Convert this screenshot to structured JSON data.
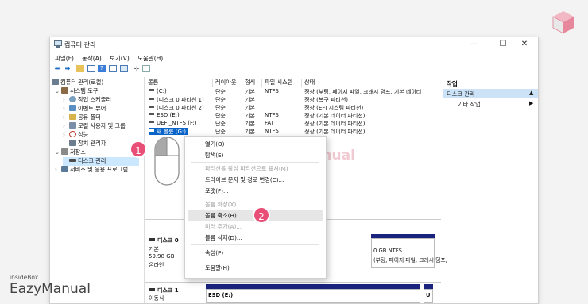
{
  "window": {
    "title": "컴퓨터 관리",
    "controls": [
      "—",
      "☐",
      "✕"
    ]
  },
  "menu": [
    "파일(F)",
    "동작(A)",
    "보기(V)",
    "도움말(H)"
  ],
  "toolbar_icons": [
    "back-arrow",
    "forward-arrow",
    "folder",
    "list",
    "help",
    "view",
    "zoom",
    "panel"
  ],
  "tree": [
    {
      "label": "컴퓨터 관리(로컬)",
      "indent": 0,
      "twisty": "",
      "color": "#6b7d8f"
    },
    {
      "label": "시스템 도구",
      "indent": 1,
      "twisty": "⌄",
      "color": "#8a6b45"
    },
    {
      "label": "작업 스케줄러",
      "indent": 2,
      "twisty": "›",
      "color": "#7aa0bf"
    },
    {
      "label": "이벤트 뷰어",
      "indent": 2,
      "twisty": "›",
      "color": "#5a8fc4"
    },
    {
      "label": "공유 폴더",
      "indent": 2,
      "twisty": "›",
      "color": "#d8b24a"
    },
    {
      "label": "로컬 사용자 및 그룹",
      "indent": 2,
      "twisty": "›",
      "color": "#7b8fa8"
    },
    {
      "label": "성능",
      "indent": 2,
      "twisty": "›",
      "color": "#c0392b"
    },
    {
      "label": "장치 관리자",
      "indent": 2,
      "twisty": "",
      "color": "#6b7d8f"
    },
    {
      "label": "저장소",
      "indent": 1,
      "twisty": "⌄",
      "color": "#8a8a8a"
    },
    {
      "label": "디스크 관리",
      "indent": 2,
      "twisty": "",
      "color": "#4a4a4a",
      "selected": true
    },
    {
      "label": "서비스 및 응용 프로그램",
      "indent": 1,
      "twisty": "›",
      "color": "#5a7a9a"
    }
  ],
  "volume_list": {
    "headers": [
      "볼륨",
      "레이아웃",
      "형식",
      "파일 시스템",
      "상태"
    ],
    "rows": [
      {
        "name": "(C:)",
        "layout": "단순",
        "type": "기본",
        "fs": "NTFS",
        "status": "정상 (부팅, 페이지 파일, 크래시 덤프, 기본 데이터"
      },
      {
        "name": "(디스크 0 파티션 1)",
        "layout": "단순",
        "type": "기본",
        "fs": "",
        "status": "정상 (복구 파티션)"
      },
      {
        "name": "(디스크 0 파티션 2)",
        "layout": "단순",
        "type": "기본",
        "fs": "",
        "status": "정상 (EFI 시스템 파티션)"
      },
      {
        "name": "ESD (E:)",
        "layout": "단순",
        "type": "기본",
        "fs": "NTFS",
        "status": "정상 (기본 데이터 파티션)"
      },
      {
        "name": "UEFI_NTFS (F:)",
        "layout": "단순",
        "type": "기본",
        "fs": "FAT",
        "status": "정상 (기본 데이터 파티션)"
      },
      {
        "name": "새 볼륨 (G:)",
        "layout": "단순",
        "type": "기본",
        "fs": "NTFS",
        "status": "정상 (기본 데이터 파티션)",
        "selected": true
      }
    ]
  },
  "disk0": {
    "label": "디스크 0",
    "kind": "기본",
    "size": "59.98 GB",
    "state": "온라인",
    "partition_size": "0 GB NTFS",
    "partition_status": "(부팅, 페이지 파일, 크래시 덤프,"
  },
  "disk1": {
    "label": "디스크 1",
    "kind": "이동식",
    "partition_name": "ESD (E:)",
    "partition_tail": "U"
  },
  "actions": {
    "title": "작업",
    "section": "디스크 관리",
    "item": "기타 작업"
  },
  "context_menu": {
    "items": [
      {
        "label": "열기(O)",
        "disabled": false
      },
      {
        "label": "탐색(E)",
        "disabled": false
      },
      {
        "sep": true
      },
      {
        "label": "파티션을 활성 파티션으로 표시(M)",
        "disabled": true
      },
      {
        "label": "드라이브 문자 및 경로 변경(C)...",
        "disabled": false
      },
      {
        "label": "포맷(F)...",
        "disabled": false
      },
      {
        "sep": true
      },
      {
        "label": "볼륨 확장(X)...",
        "disabled": true
      },
      {
        "label": "볼륨 축소(H)...",
        "disabled": false,
        "highlight": true
      },
      {
        "label": "미러 추가(A)...",
        "disabled": true
      },
      {
        "label": "볼륨 삭제(D)...",
        "disabled": false
      },
      {
        "sep": true
      },
      {
        "label": "속성(P)",
        "disabled": false
      },
      {
        "sep": true
      },
      {
        "label": "도움말(H)",
        "disabled": false
      }
    ]
  },
  "badges": [
    "1",
    "2"
  ],
  "watermark": {
    "line1": "insideBox",
    "line2": "EazyManual"
  },
  "branding": {
    "small": "insideBox",
    "big": "EazyManual"
  },
  "colors": {
    "accent": "#e94e77",
    "selection": "#cce8ff",
    "volume_bar": "#1a237e"
  }
}
